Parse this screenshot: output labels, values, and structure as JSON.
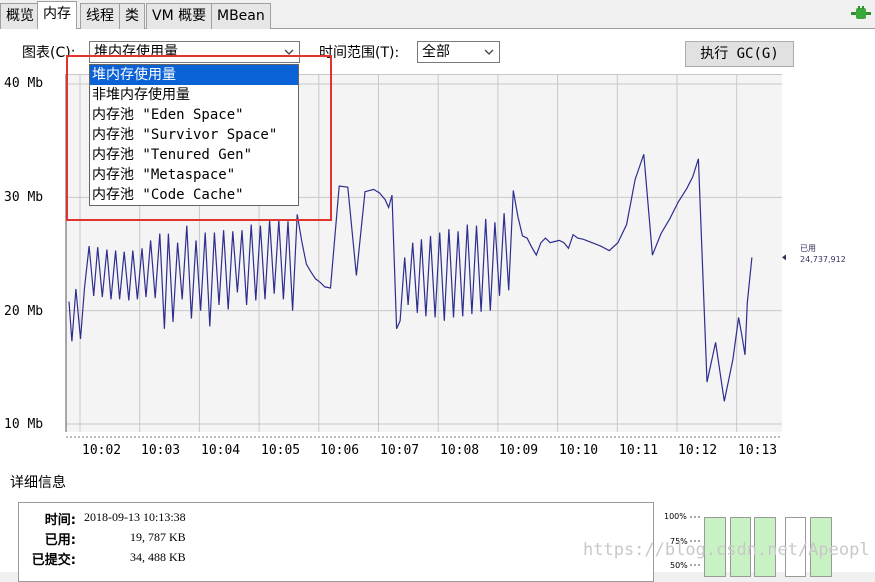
{
  "tabs": [
    "概览",
    "内存",
    "线程",
    "类",
    "VM 概要",
    "MBean"
  ],
  "active_tab": 1,
  "toolbar": {
    "chart_label": "图表(C):",
    "chart_value": "堆内存使用量",
    "time_range_label": "时间范围(T):",
    "time_range_value": "全部",
    "gc_button": "执行 GC(G)"
  },
  "dropdown": {
    "items": [
      "堆内存使用量",
      "非堆内存使用量",
      "内存池 \"Eden Space\"",
      "内存池 \"Survivor Space\"",
      "内存池 \"Tenured Gen\"",
      "内存池 \"Metaspace\"",
      "内存池 \"Code Cache\""
    ],
    "selected_index": 0
  },
  "chart_data": {
    "type": "line",
    "y_ticks": [
      "40 Mb",
      "30 Mb",
      "20 Mb",
      "10 Mb"
    ],
    "x_ticks": [
      "10:02",
      "10:03",
      "10:04",
      "10:05",
      "10:06",
      "10:07",
      "10:08",
      "10:09",
      "10:10",
      "10:11",
      "10:12",
      "10:13"
    ],
    "ylim": [
      10,
      40
    ],
    "xlim": [
      0,
      12.3
    ],
    "series_label": "已用",
    "series_value": "24,737,912",
    "color": "#2e2e8f",
    "x": [
      0.0,
      0.05,
      0.12,
      0.2,
      0.27,
      0.35,
      0.43,
      0.5,
      0.58,
      0.66,
      0.73,
      0.81,
      0.88,
      0.96,
      1.04,
      1.11,
      1.19,
      1.27,
      1.34,
      1.42,
      1.5,
      1.58,
      1.66,
      1.73,
      1.81,
      1.89,
      1.97,
      2.05,
      2.13,
      2.21,
      2.29,
      2.37,
      2.45,
      2.53,
      2.61,
      2.69,
      2.77,
      2.85,
      2.93,
      3.01,
      3.09,
      3.17,
      3.25,
      3.33,
      3.41,
      3.49,
      3.57,
      3.65,
      3.73,
      3.81,
      3.89,
      3.97,
      4.05,
      4.13,
      4.21,
      4.29,
      4.37,
      4.45,
      4.55,
      4.7,
      4.85,
      5.0,
      5.15,
      5.3,
      5.4,
      5.5,
      5.56,
      5.62,
      5.7,
      5.76,
      5.84,
      5.9,
      5.98,
      6.06,
      6.13,
      6.21,
      6.29,
      6.37,
      6.45,
      6.53,
      6.61,
      6.69,
      6.77,
      6.85,
      6.93,
      7.01,
      7.09,
      7.17,
      7.25,
      7.33,
      7.41,
      7.49,
      7.57,
      7.65,
      7.73,
      7.81,
      7.89,
      7.97,
      8.05,
      8.13,
      8.21,
      8.29,
      8.37,
      8.45,
      8.53,
      8.61,
      8.69,
      8.77,
      8.85,
      8.95,
      9.1,
      9.25,
      9.4,
      9.55,
      9.7,
      9.85,
      10.0,
      10.15,
      10.3,
      10.45,
      10.6,
      10.75,
      10.85,
      10.95,
      11.1,
      11.25,
      11.4,
      11.55,
      11.65,
      11.7,
      11.76,
      11.8,
      11.88,
      11.95,
      12.02,
      12.1,
      12.18,
      12.25
    ],
    "y": [
      20.8,
      17.3,
      21.9,
      17.5,
      22.0,
      25.7,
      21.3,
      25.6,
      21.2,
      25.4,
      21.0,
      25.3,
      21.0,
      25.2,
      20.9,
      25.3,
      21.0,
      25.5,
      21.2,
      26.2,
      21.1,
      26.8,
      18.4,
      26.8,
      19.0,
      26.0,
      21.0,
      27.5,
      19.3,
      26.2,
      20.0,
      26.9,
      18.6,
      26.9,
      20.5,
      27.1,
      20.1,
      27.0,
      21.6,
      27.1,
      20.5,
      27.6,
      20.9,
      27.5,
      21.0,
      28.0,
      21.5,
      28.0,
      21.0,
      27.9,
      20.0,
      28.5,
      26.1,
      24.1,
      23.4,
      22.8,
      22.5,
      22.1,
      22.0,
      31.0,
      30.9,
      23.1,
      30.5,
      30.7,
      30.4,
      29.8,
      29.1,
      30.2,
      18.4,
      19.1,
      24.7,
      20.5,
      26.0,
      19.8,
      26.3,
      19.5,
      26.6,
      19.4,
      26.9,
      19.1,
      27.2,
      19.4,
      27.0,
      19.5,
      27.6,
      19.7,
      27.5,
      19.9,
      28.1,
      20.0,
      27.8,
      21.3,
      28.6,
      21.8,
      30.6,
      28.3,
      26.6,
      26.4,
      25.6,
      24.9,
      26.0,
      26.4,
      26.0,
      26.1,
      26.2,
      26.0,
      25.5,
      26.7,
      26.4,
      26.3,
      26.0,
      25.7,
      25.3,
      26.0,
      27.6,
      31.6,
      33.8,
      24.9,
      26.8,
      28.1,
      29.6,
      30.8,
      31.8,
      33.4,
      13.7,
      17.2,
      12.0,
      15.7,
      19.4,
      18.0,
      16.1,
      20.7,
      24.7
    ]
  },
  "details": {
    "title": "详细信息",
    "rows": [
      {
        "label": "时间:",
        "value": "2018-09-13 10:13:38"
      },
      {
        "label": "已用:",
        "value": "19, 787 KB"
      },
      {
        "label": "已提交:",
        "value": "34, 488 KB"
      }
    ]
  },
  "mini_axis": [
    "100%",
    "75%",
    "50%"
  ],
  "watermark": "https://blog.csdn.net/Apeopl"
}
